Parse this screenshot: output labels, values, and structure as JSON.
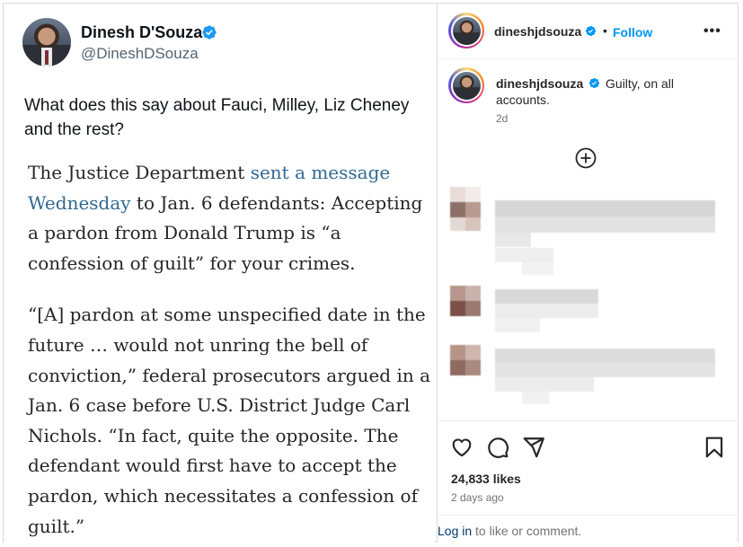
{
  "tweet": {
    "display_name": "Dinesh D'Souza",
    "handle": "@DineshDSouza",
    "text": "What does this say about Fauci, Milley, Liz Cheney and the rest?",
    "article": {
      "p1_before": "The Justice Department ",
      "p1_link": "sent a message Wednesday",
      "p1_after": " to Jan. 6 defendants: Accepting a pardon from Donald Trump is “a confession of guilt” for your crimes.",
      "p2": "“[A] pardon at some unspecified date in the future … would not unring the bell of conviction,” federal prosecutors argued in a Jan. 6 case before U.S. District Judge Carl Nichols. “In fact, quite the opposite. The defendant would first have to accept the pardon, which necessitates a confession of guilt.”"
    }
  },
  "instagram": {
    "header": {
      "username": "dineshjdsouza",
      "separator": "•",
      "follow_label": "Follow",
      "more_label": "•••"
    },
    "caption": {
      "username": "dineshjdsouza",
      "text": "Guilty, on all accounts.",
      "time": "2d"
    },
    "likes": "24,833 likes",
    "date": "2 days ago",
    "login": {
      "link": "Log in",
      "text": " to like or comment."
    }
  },
  "colors": {
    "link_blue_article": "#326891",
    "instagram_blue": "#0095f6",
    "verified_blue": "#1d9bf0"
  }
}
